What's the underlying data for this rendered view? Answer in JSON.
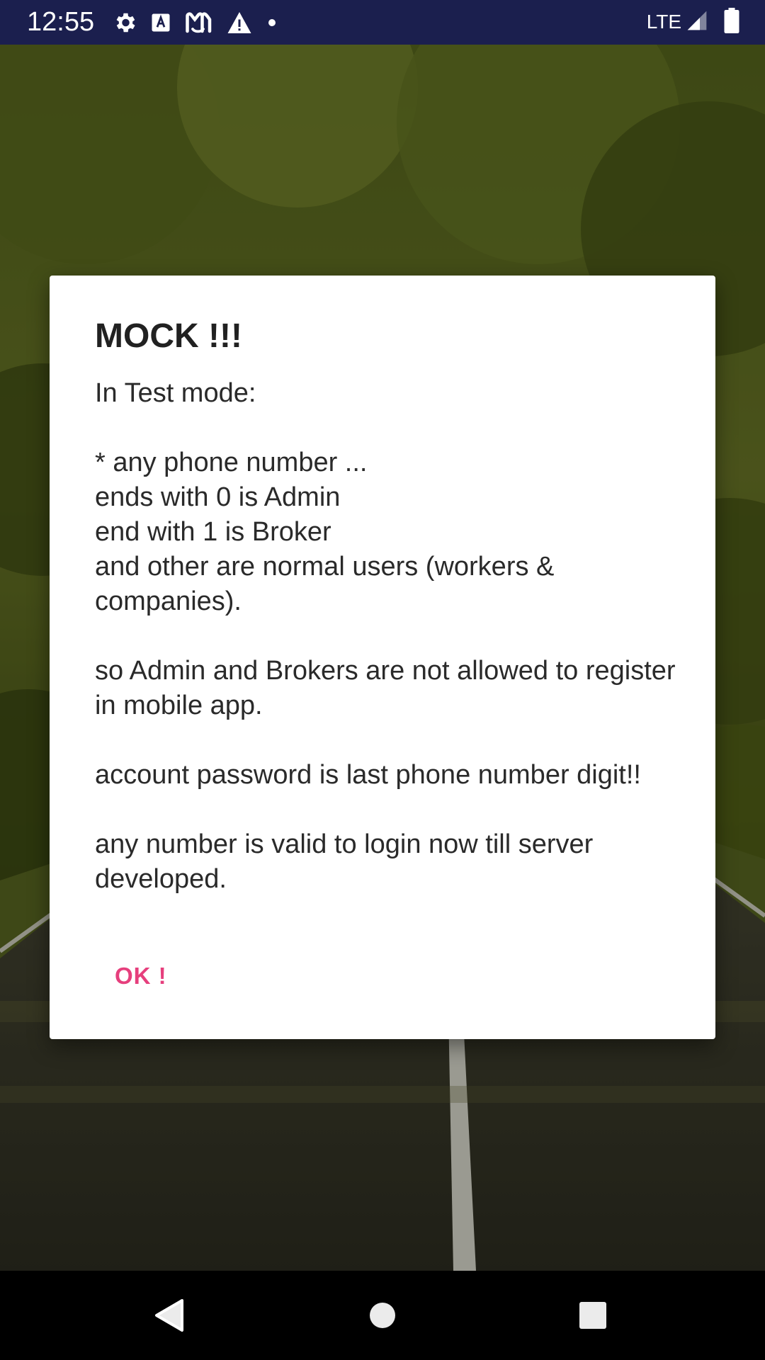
{
  "status_bar": {
    "time": "12:55",
    "network": "LTE",
    "icons": [
      "settings-icon",
      "text-a-icon",
      "m-app-icon",
      "warning-icon",
      "dot-icon",
      "signal-icon",
      "battery-icon"
    ]
  },
  "background": {
    "description_icon": "road-through-trees-image"
  },
  "dialog": {
    "title": "MOCK !!!",
    "message": "In Test mode:\n\n* any phone number ...\nends with 0 is Admin\nend with 1 is Broker\nand other are normal users (workers & companies).\n\nso Admin and Brokers are not allowed to register in mobile app.\n\naccount password is last phone number digit!!\n\nany number is valid to login now till server developed.",
    "ok_label": "OK !"
  },
  "colors": {
    "status_bar": "#1b1f4e",
    "accent": "#e63f7d",
    "dialog_bg": "#ffffff"
  },
  "nav_bar": {
    "icons": [
      "back-icon",
      "home-icon",
      "recents-icon"
    ]
  }
}
